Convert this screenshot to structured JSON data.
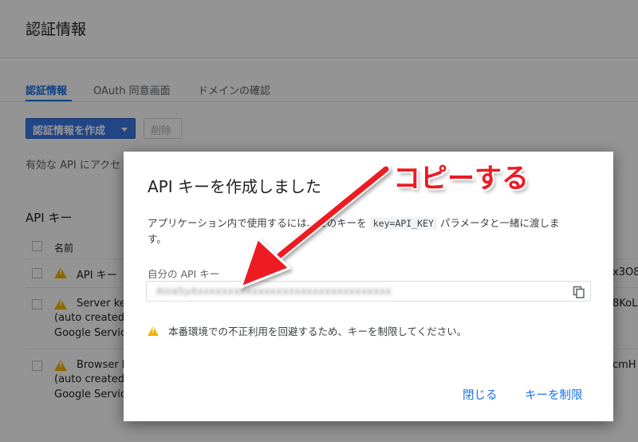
{
  "page": {
    "title": "認証情報",
    "tabs": [
      {
        "label": "認証情報",
        "active": true
      },
      {
        "label": "OAuth 同意画面",
        "active": false
      },
      {
        "label": "ドメインの確認",
        "active": false
      }
    ],
    "create_button": "認証情報を作成",
    "delete_button": "削除",
    "description_partial": "有効な API にアクセ",
    "api_keys_heading": "API キー",
    "column_name": "名前",
    "rows": [
      {
        "name": "API キー",
        "sub1": "",
        "sub2": "",
        "right": "x3O8"
      },
      {
        "name": "Server ke",
        "sub1": "(auto created",
        "sub2": "Google Servic",
        "right": "8KoL"
      },
      {
        "name": "Browser k",
        "sub1": "(auto created",
        "sub2": "Google Servic",
        "right": "cmH"
      }
    ]
  },
  "dialog": {
    "title": "API キーを作成しました",
    "body_before": "アプリケーション内で使用するには、このキーを",
    "body_code": "key=API_KEY",
    "body_after": "パラメータと一緒に渡します。",
    "key_label": "自分の API キー",
    "key_value": "AIzaSyAxxxxxxxxxxxxxxxxxxxxxxxxxxxxxxxx",
    "warning": "本番環境での不正利用を回避するため、キーを制限してください。",
    "close_button": "閉じる",
    "restrict_button": "キーを制限"
  },
  "annotation": {
    "callout_text": "コピーする",
    "color": "#ee1a24"
  },
  "colors": {
    "accent": "#1a73e8",
    "primary_button": "#3b78e7",
    "warning": "#f4b400"
  },
  "icons": {
    "copy": "copy-icon",
    "warning": "warning-icon",
    "dropdown": "caret-down-icon"
  }
}
